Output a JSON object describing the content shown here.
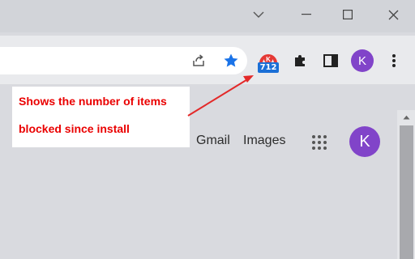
{
  "window": {
    "minimize_icon": "minus-icon",
    "maximize_icon": "square-icon",
    "close_icon": "x-icon"
  },
  "toolbar": {
    "profile_initial": "K",
    "extension_badge": "712",
    "accent_color": "#1a73e8",
    "avatar_color": "#8144c9"
  },
  "callout": {
    "line1": "Shows the number of items",
    "line2": "blocked since install",
    "color": "#ea0000"
  },
  "page": {
    "gmail_label": "Gmail",
    "images_label": "Images",
    "profile_initial": "K"
  }
}
